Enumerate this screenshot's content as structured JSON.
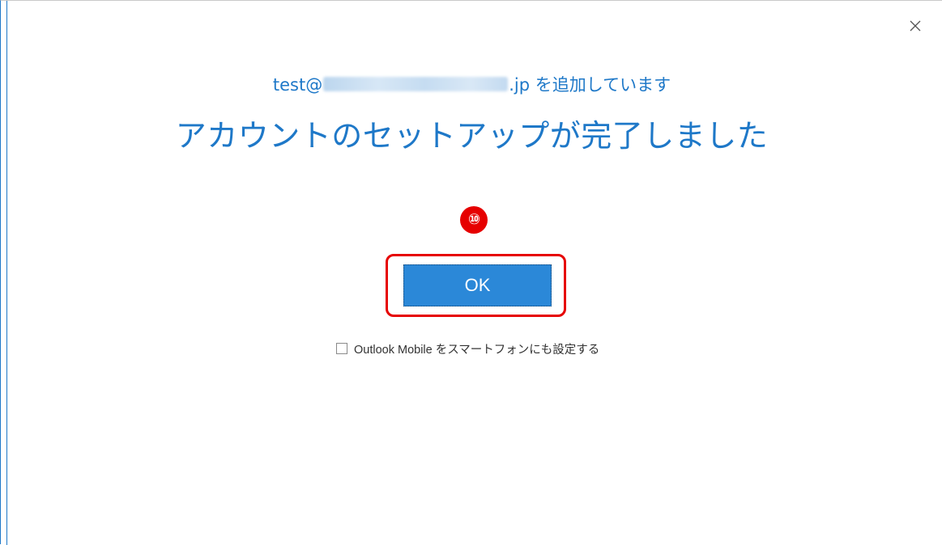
{
  "window": {
    "close_icon": "close-icon"
  },
  "header": {
    "subtitle_prefix": "test@",
    "subtitle_suffix": ".jp を追加しています",
    "title": "アカウントのセットアップが完了しました"
  },
  "annotation": {
    "step_number": "⑩",
    "highlight_color": "#e60000"
  },
  "actions": {
    "ok_label": "OK"
  },
  "options": {
    "mobile_checked": false,
    "mobile_label": "Outlook Mobile をスマートフォンにも設定する"
  },
  "colors": {
    "accent": "#1e78c8",
    "button": "#2b88d8"
  }
}
